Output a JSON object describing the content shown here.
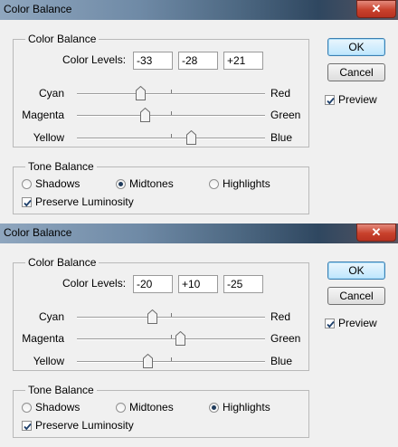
{
  "dialogs": [
    {
      "title": "Color Balance",
      "close_label": "✕",
      "color_balance_legend": "Color Balance",
      "color_levels_label": "Color Levels:",
      "levels": [
        "-33",
        "-28",
        "+21"
      ],
      "sliders": [
        {
          "left": "Cyan",
          "right": "Red",
          "value": -33
        },
        {
          "left": "Magenta",
          "right": "Green",
          "value": -28
        },
        {
          "left": "Yellow",
          "right": "Blue",
          "value": 21
        }
      ],
      "ok_label": "OK",
      "cancel_label": "Cancel",
      "preview_label": "Preview",
      "preview_checked": true,
      "tone_balance_legend": "Tone Balance",
      "tones": [
        "Shadows",
        "Midtones",
        "Highlights"
      ],
      "selected_tone": "Midtones",
      "preserve_luminosity_label": "Preserve Luminosity",
      "preserve_luminosity_checked": true
    },
    {
      "title": "Color Balance",
      "close_label": "✕",
      "color_balance_legend": "Color Balance",
      "color_levels_label": "Color Levels:",
      "levels": [
        "-20",
        "+10",
        "-25"
      ],
      "sliders": [
        {
          "left": "Cyan",
          "right": "Red",
          "value": -20
        },
        {
          "left": "Magenta",
          "right": "Green",
          "value": 10
        },
        {
          "left": "Yellow",
          "right": "Blue",
          "value": -25
        }
      ],
      "ok_label": "OK",
      "cancel_label": "Cancel",
      "preview_label": "Preview",
      "preview_checked": true,
      "tone_balance_legend": "Tone Balance",
      "tones": [
        "Shadows",
        "Midtones",
        "Highlights"
      ],
      "selected_tone": "Highlights",
      "preserve_luminosity_label": "Preserve Luminosity",
      "preserve_luminosity_checked": true
    }
  ],
  "slider_range": [
    -100,
    100
  ],
  "colors": {
    "default_button_border": "#3c7fb1",
    "title_bar_dark": "#2f4760",
    "close_button": "#c8412c"
  }
}
